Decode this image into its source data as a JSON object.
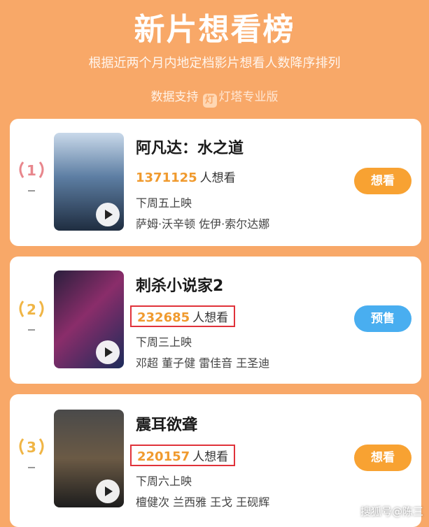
{
  "header": {
    "title": "新片想看榜",
    "subtitle": "根据近两个月内地定档影片想看人数降序排列",
    "source_label": "数据支持",
    "source_logo": "灯",
    "source_brand": "灯塔专业版"
  },
  "movies": [
    {
      "rank": "1",
      "title": "阿凡达：水之道",
      "want_count": "1371125",
      "want_label": "人想看",
      "release": "下周五上映",
      "cast": "萨姆·沃辛顿 佐伊·索尔达娜",
      "button": "想看",
      "rank_color": "#e8868c",
      "poster_colors": [
        "#b9cde0",
        "#4e6f93",
        "#223247"
      ]
    },
    {
      "rank": "2",
      "title": "刺杀小说家2",
      "want_count": "232685",
      "want_label": "人想看",
      "release": "下周三上映",
      "cast": "邓超 董子健 雷佳音 王圣迪",
      "button": "预售",
      "rank_color": "#f0b545",
      "poster_colors": [
        "#2a1f3d",
        "#7a2e6e",
        "#1c2b5a"
      ]
    },
    {
      "rank": "3",
      "title": "震耳欲聋",
      "want_count": "220157",
      "want_label": "人想看",
      "release": "下周六上映",
      "cast": "檀健次 兰西雅 王戈 王砚辉",
      "button": "想看",
      "rank_color": "#f0b545",
      "poster_colors": [
        "#3a3a3a",
        "#6b5a45",
        "#1d1d1d"
      ]
    }
  ],
  "watermark": "搜狐号@陈三"
}
